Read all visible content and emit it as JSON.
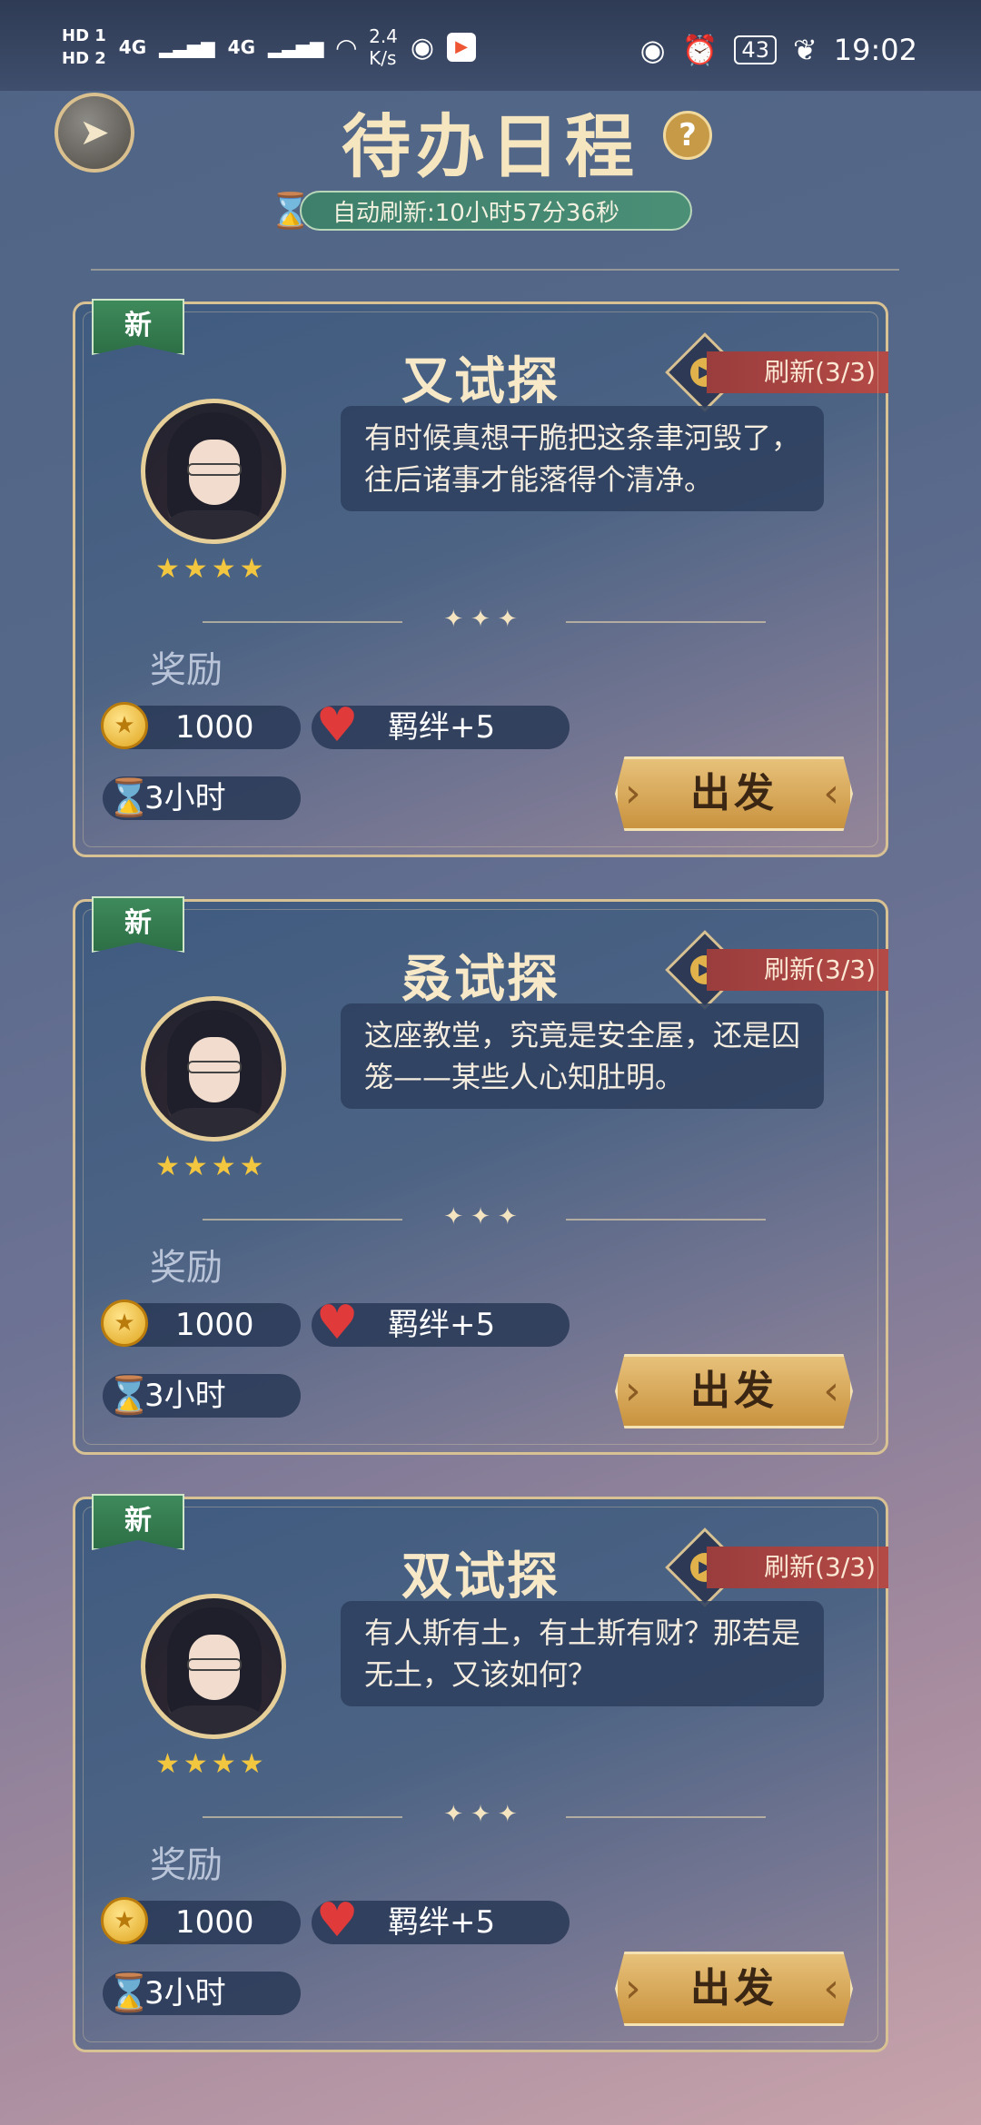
{
  "status_bar": {
    "left": {
      "hd1": "HD 1",
      "hd2": "HD 2",
      "net1": "4G",
      "net2": "4G",
      "speed_value": "2.4",
      "speed_unit": "K/s"
    },
    "right": {
      "battery": "43",
      "time": "19:02"
    }
  },
  "header": {
    "title": "待办日程",
    "help": "?",
    "auto_refresh": "自动刷新:10小时57分36秒"
  },
  "cards": [
    {
      "badge": "新",
      "title": "又试探",
      "refresh": "刷新(3/3)",
      "quote": "有时候真想干脆把这条聿河毁了，往后诸事才能落得个清净。",
      "stars": "★★★★",
      "reward_label": "奖励",
      "coins": "1000",
      "bond": "羁绊+5",
      "duration": "3小时",
      "go": "出发"
    },
    {
      "badge": "新",
      "title": "叒试探",
      "refresh": "刷新(3/3)",
      "quote": "这座教堂，究竟是安全屋，还是囚笼——某些人心知肚明。",
      "stars": "★★★★",
      "reward_label": "奖励",
      "coins": "1000",
      "bond": "羁绊+5",
      "duration": "3小时",
      "go": "出发"
    },
    {
      "badge": "新",
      "title": "双试探",
      "refresh": "刷新(3/3)",
      "quote": "有人斯有土，有土斯有财？那若是无土，又该如何？",
      "stars": "★★★★",
      "reward_label": "奖励",
      "coins": "1000",
      "bond": "羁绊+5",
      "duration": "3小时",
      "go": "出发"
    }
  ],
  "icons": {
    "back": "back-arrow-icon",
    "coin": "coin-icon",
    "heart": "heart-icon",
    "hourglass": "hourglass-icon",
    "play": "play-icon"
  },
  "colors": {
    "accent_gold": "#d8c193",
    "button_gold": "#c9933f",
    "refresh_red": "#b44a46",
    "new_green": "#3e8a5b"
  }
}
